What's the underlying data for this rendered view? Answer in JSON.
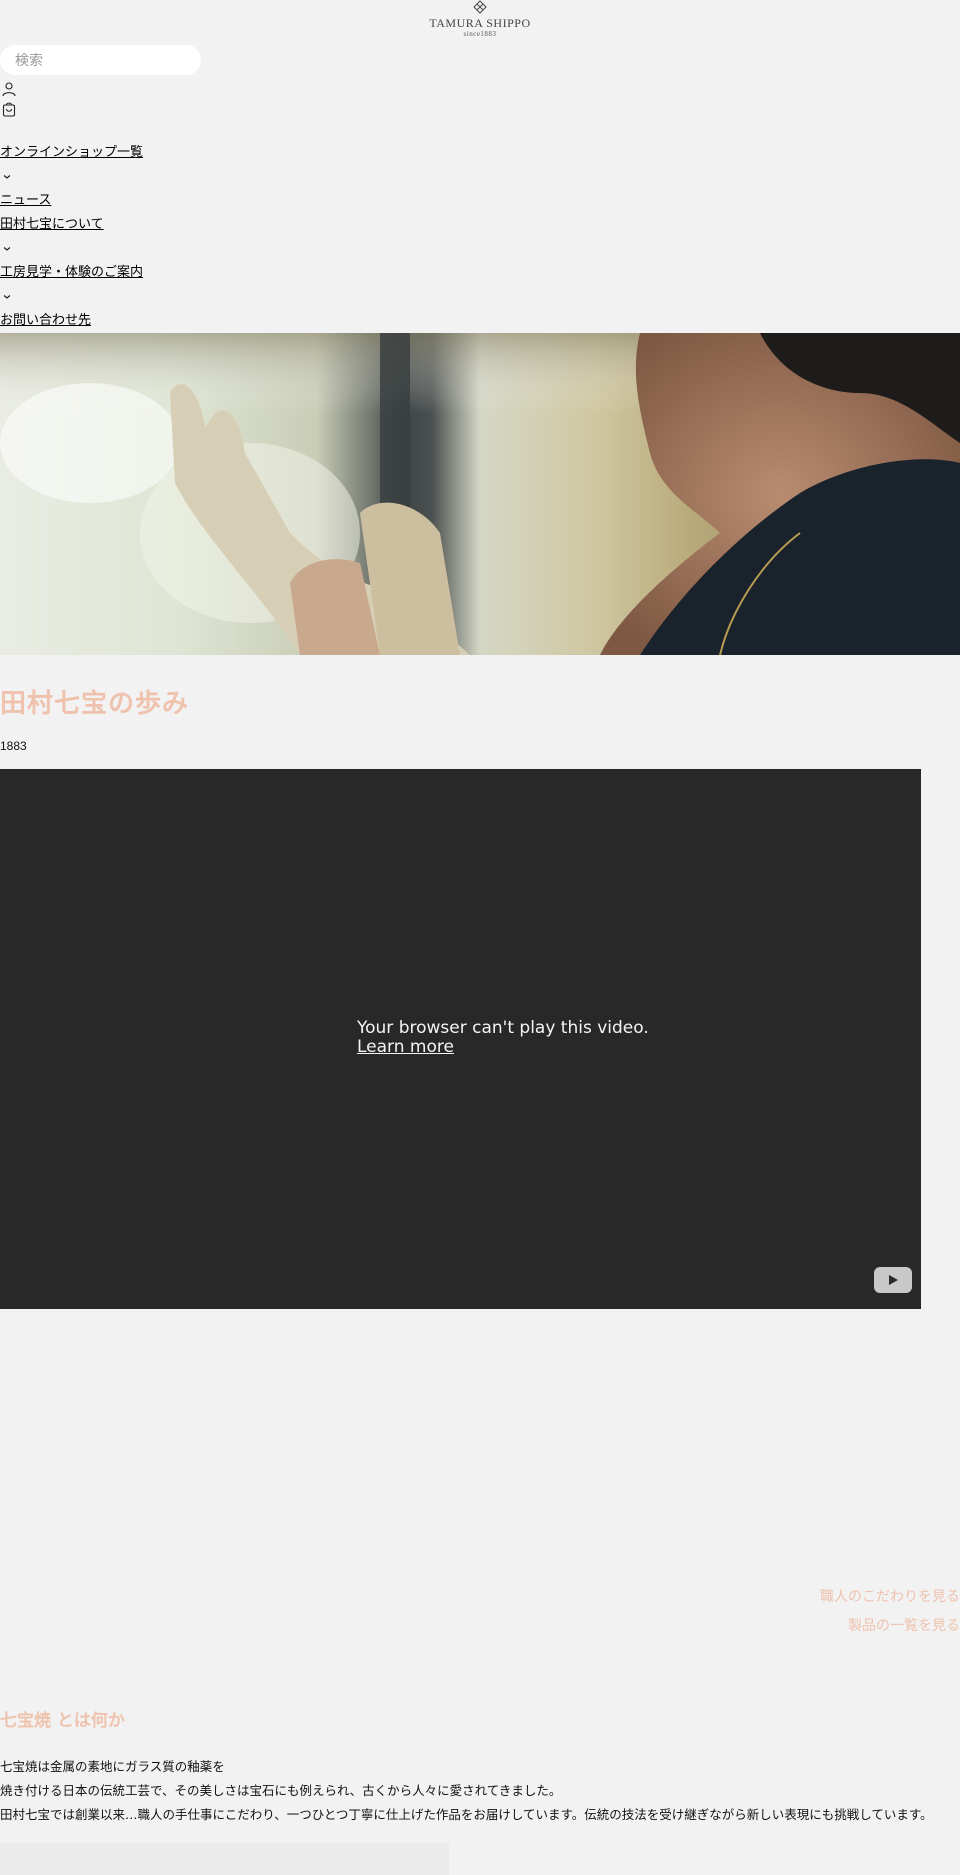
{
  "header": {
    "brand_name": "TAMURA SHIPPO",
    "brand_since": "since1883",
    "search_placeholder": "検索"
  },
  "icons": {
    "account": "user-icon",
    "cart": "shopping-bag-icon",
    "chevron": "chevron-down-icon",
    "youtube": "youtube-play-icon"
  },
  "nav": {
    "items": [
      {
        "label": "オンラインショップ一覧",
        "has_dropdown": true
      },
      {
        "label": "ニュース",
        "has_dropdown": false
      },
      {
        "label": "田村七宝について",
        "has_dropdown": true
      },
      {
        "label": "工房見学・体験のご案内",
        "has_dropdown": true
      },
      {
        "label": "お問い合わせ先",
        "has_dropdown": false
      }
    ]
  },
  "hero": {
    "alt": "Artisan putting on work gloves"
  },
  "intro": {
    "title": "田村七宝の歩み",
    "year": "1883"
  },
  "video": {
    "message": "Your browser can't play this video.",
    "link_label": "Learn more"
  },
  "side_links": [
    "職人のこだわりを見る",
    "製品の一覧を見る"
  ],
  "section": {
    "title": "七宝焼 とは何か",
    "paragraphs": [
      "七宝焼は金属の素地にガラス質の釉薬を",
      "焼き付ける日本の伝統工芸で、その美しさは宝石にも例えられ、古くから人々に愛されてきました。",
      "田村七宝では創業以来…職人の手仕事にこだわり、一つひとつ丁寧に仕上げた作品をお届けしています。伝統の技法を受け継ぎながら新しい表現にも挑戦しています。"
    ]
  },
  "colors": {
    "background": "#f2f2f2",
    "accent": "#efc2ad",
    "video_bg": "#282828"
  }
}
